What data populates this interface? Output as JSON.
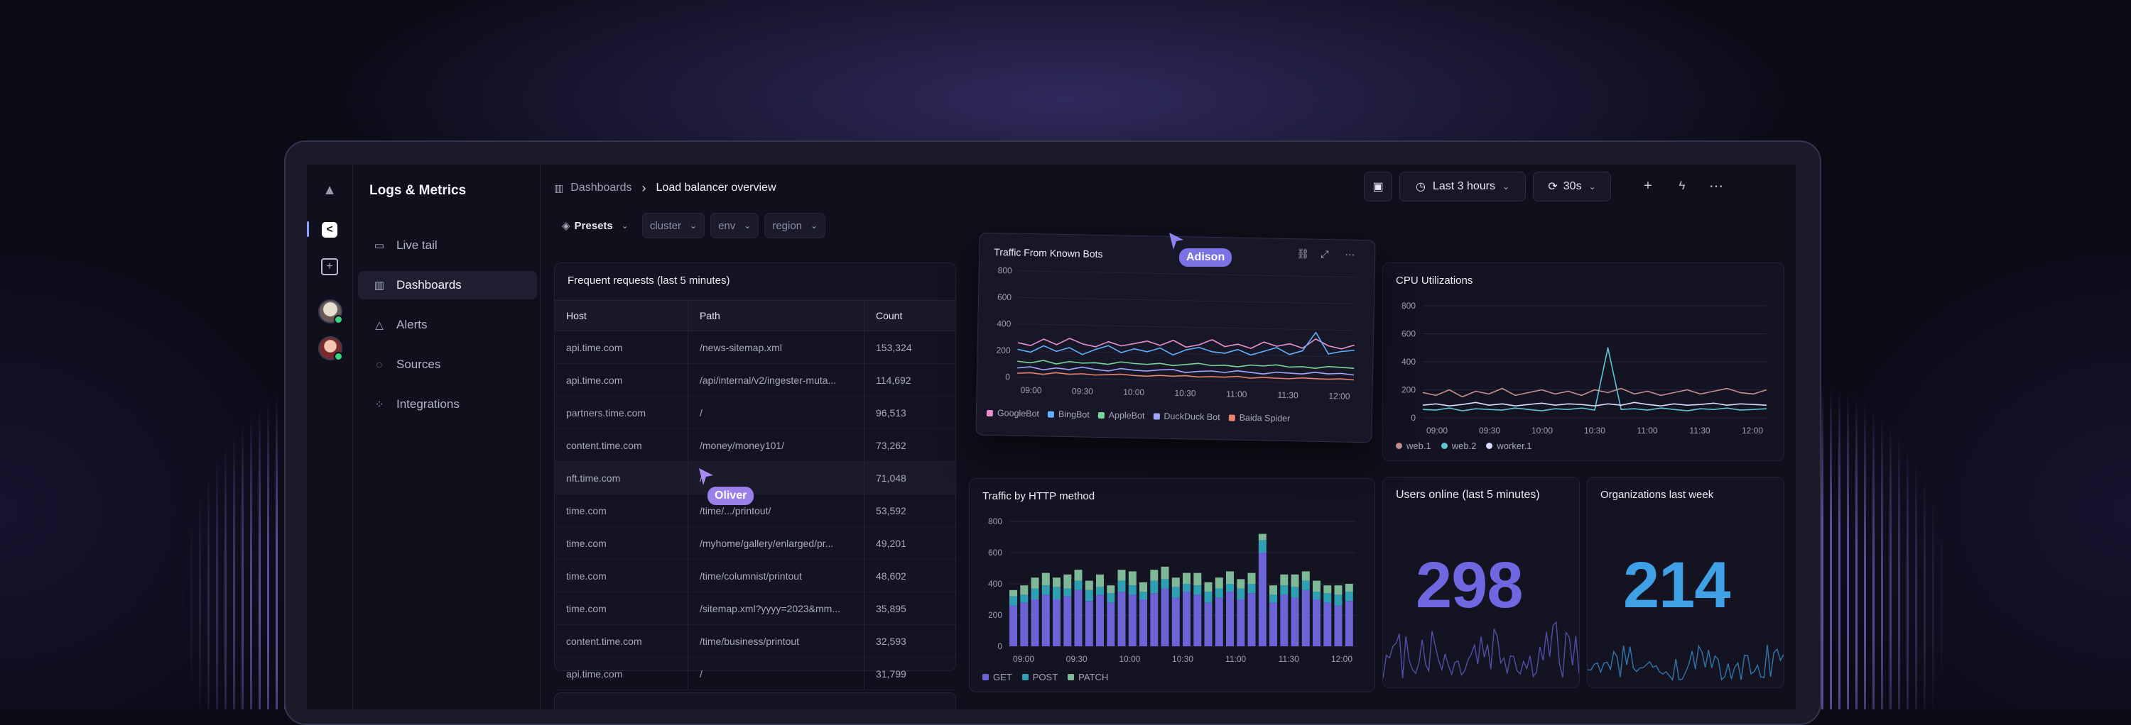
{
  "app": {
    "title": "Logs & Metrics"
  },
  "nav": [
    {
      "label": "Live tail",
      "icon": "live-tail-icon"
    },
    {
      "label": "Dashboards",
      "icon": "dashboards-icon",
      "active": true
    },
    {
      "label": "Alerts",
      "icon": "alert-icon"
    },
    {
      "label": "Sources",
      "icon": "sources-icon"
    },
    {
      "label": "Integrations",
      "icon": "integrations-icon"
    }
  ],
  "breadcrumb": {
    "root": "Dashboards",
    "current": "Load balancer overview"
  },
  "toolbar": {
    "time_range": "Last 3 hours",
    "refresh": "30s"
  },
  "filters": {
    "presets": "Presets",
    "cluster": "cluster",
    "env": "env",
    "region": "region"
  },
  "frequent_requests": {
    "title": "Frequent requests (last 5 minutes)",
    "columns": [
      "Host",
      "Path",
      "Count"
    ],
    "rows": [
      [
        "api.time.com",
        "/news-sitemap.xml",
        "153,324"
      ],
      [
        "api.time.com",
        "/api/internal/v2/ingester-muta...",
        "114,692"
      ],
      [
        "partners.time.com",
        "/",
        "96,513"
      ],
      [
        "content.time.com",
        "/money/money101/",
        "73,262"
      ],
      [
        "nft.time.com",
        "/",
        "71,048"
      ],
      [
        "time.com",
        "/time/.../printout/",
        "53,592"
      ],
      [
        "time.com",
        "/myhome/gallery/enlarged/pr...",
        "49,201"
      ],
      [
        "time.com",
        "/time/columnist/printout",
        "48,602"
      ],
      [
        "time.com",
        "/sitemap.xml?yyyy=2023&mm...",
        "35,895"
      ],
      [
        "content.time.com",
        "/time/business/printout",
        "32,593"
      ],
      [
        "api.time.com",
        "/",
        "31,799"
      ]
    ]
  },
  "collaborators": {
    "oliver": "Oliver",
    "adison": "Adison"
  },
  "chart_data": [
    {
      "type": "line",
      "title": "Traffic From Known Bots",
      "x": [
        "09:00",
        "09:30",
        "10:00",
        "10:30",
        "11:00",
        "11:30",
        "12:00"
      ],
      "ylim": [
        0,
        800
      ],
      "yticks": [
        0,
        200,
        400,
        600,
        800
      ],
      "series": [
        {
          "name": "GoogleBot",
          "color": "#e88fd0",
          "values": [
            260,
            240,
            290,
            250,
            300,
            260,
            240,
            280,
            250,
            270,
            290,
            260,
            300,
            250,
            270,
            310,
            260,
            280,
            250,
            300,
            270,
            290,
            260,
            330,
            280,
            260,
            290
          ]
        },
        {
          "name": "BingBot",
          "color": "#5fb0ff",
          "values": [
            210,
            190,
            240,
            200,
            230,
            180,
            220,
            250,
            200,
            230,
            210,
            240,
            190,
            230,
            250,
            220,
            210,
            240,
            200,
            230,
            260,
            210,
            240,
            380,
            220,
            240,
            250
          ]
        },
        {
          "name": "AppleBot",
          "color": "#7ad49a",
          "values": [
            120,
            110,
            130,
            105,
            125,
            115,
            120,
            110,
            130,
            120,
            115,
            125,
            110,
            120,
            130,
            115,
            120,
            110,
            125,
            120,
            130,
            115,
            120,
            110,
            125,
            120,
            115
          ]
        },
        {
          "name": "DuckDuck Bot",
          "color": "#9fa8ff",
          "values": [
            70,
            80,
            60,
            75,
            65,
            85,
            70,
            60,
            80,
            70,
            65,
            75,
            80,
            60,
            70,
            75,
            65,
            80,
            70,
            60,
            75,
            70,
            65,
            80,
            70,
            75,
            65
          ]
        },
        {
          "name": "Baida Spider",
          "color": "#e8826a",
          "values": [
            30,
            35,
            25,
            40,
            30,
            35,
            28,
            32,
            38,
            30,
            26,
            34,
            30,
            36,
            28,
            32,
            30,
            38,
            26,
            34,
            30,
            28,
            36,
            32,
            30,
            34,
            28
          ]
        }
      ]
    },
    {
      "type": "line",
      "title": "CPU Utilizations",
      "x": [
        "09:00",
        "09:30",
        "10:00",
        "10:30",
        "11:00",
        "11:30",
        "12:00"
      ],
      "ylim": [
        0,
        800
      ],
      "yticks": [
        0,
        200,
        400,
        600,
        800
      ],
      "series": [
        {
          "name": "web.1",
          "color": "#c98f8f",
          "values": [
            180,
            160,
            200,
            150,
            190,
            170,
            210,
            160,
            180,
            200,
            170,
            190,
            160,
            200,
            180,
            210,
            170,
            190,
            160,
            180,
            200,
            170,
            190,
            210,
            180,
            170,
            200
          ]
        },
        {
          "name": "web.2",
          "color": "#5fc4d4",
          "values": [
            60,
            55,
            70,
            50,
            65,
            60,
            55,
            70,
            60,
            50,
            65,
            60,
            70,
            55,
            500,
            60,
            65,
            55,
            70,
            60,
            50,
            65,
            60,
            70,
            55,
            60,
            65
          ]
        },
        {
          "name": "worker.1",
          "color": "#d8dcff",
          "values": [
            90,
            100,
            85,
            95,
            110,
            90,
            100,
            85,
            95,
            105,
            90,
            100,
            95,
            85,
            100,
            90,
            110,
            95,
            85,
            100,
            90,
            95,
            105,
            90,
            100,
            95,
            90
          ]
        }
      ]
    },
    {
      "type": "bar",
      "title": "Traffic by HTTP method",
      "x": [
        "09:00",
        "09:30",
        "10:00",
        "10:30",
        "11:00",
        "11:30",
        "12:00"
      ],
      "ylim": [
        0,
        800
      ],
      "yticks": [
        0,
        200,
        400,
        600,
        800
      ],
      "series": [
        {
          "name": "GET",
          "color": "#6c63d6",
          "values": [
            260,
            280,
            300,
            330,
            300,
            320,
            360,
            290,
            330,
            280,
            350,
            330,
            300,
            340,
            370,
            310,
            350,
            330,
            280,
            310,
            350,
            300,
            340,
            600,
            280,
            330,
            310,
            360,
            300,
            280,
            260,
            290
          ]
        },
        {
          "name": "POST",
          "color": "#2f9fb4",
          "values": [
            60,
            50,
            70,
            60,
            80,
            50,
            60,
            70,
            50,
            60,
            70,
            60,
            50,
            80,
            60,
            70,
            50,
            60,
            70,
            60,
            50,
            70,
            60,
            80,
            50,
            60,
            70,
            60,
            50,
            60,
            70,
            60
          ]
        },
        {
          "name": "PATCH",
          "color": "#7fb896",
          "values": [
            40,
            60,
            70,
            80,
            60,
            90,
            70,
            60,
            80,
            50,
            70,
            90,
            60,
            70,
            80,
            60,
            70,
            80,
            60,
            70,
            80,
            60,
            70,
            40,
            60,
            70,
            80,
            60,
            70,
            50,
            60,
            50
          ]
        }
      ]
    }
  ],
  "users_online": {
    "title": "Users online (last 5 minutes)",
    "value": "298",
    "color": "#6f67e0"
  },
  "organizations": {
    "title": "Organizations last week",
    "value": "214",
    "color": "#3fa0e6"
  }
}
